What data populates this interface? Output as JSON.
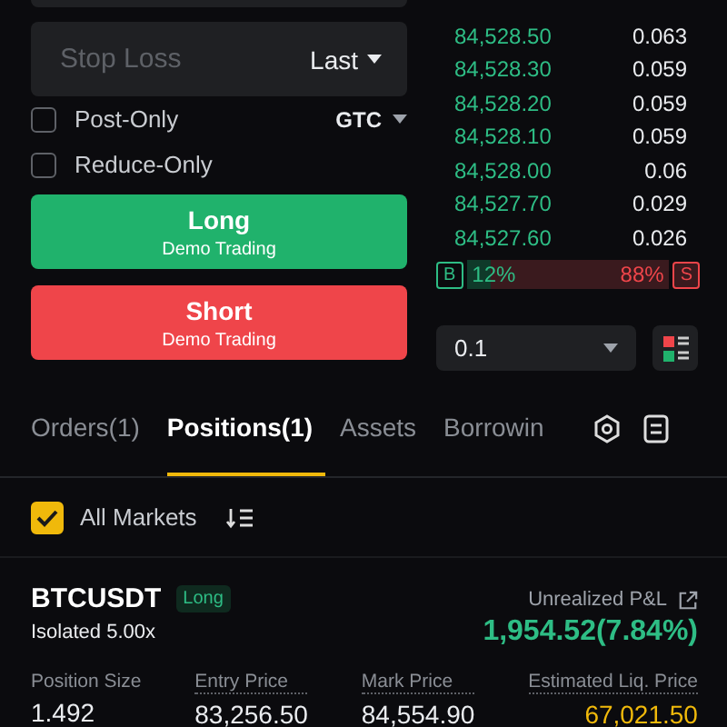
{
  "order_form": {
    "stop_loss": {
      "placeholder": "Stop Loss",
      "trigger": "Last"
    },
    "options": [
      {
        "label": "Post-Only",
        "checked": false
      },
      {
        "label": "Reduce-Only",
        "checked": false
      }
    ],
    "time_in_force": "GTC",
    "buttons": [
      {
        "kind": "long",
        "label": "Long",
        "sub": "Demo Trading"
      },
      {
        "kind": "short",
        "label": "Short",
        "sub": "Demo Trading"
      }
    ]
  },
  "order_book": {
    "rows": [
      {
        "price": "84,528.50",
        "qty": "0.063"
      },
      {
        "price": "84,528.30",
        "qty": "0.059"
      },
      {
        "price": "84,528.20",
        "qty": "0.059"
      },
      {
        "price": "84,528.10",
        "qty": "0.059"
      },
      {
        "price": "84,528.00",
        "qty": "0.06"
      },
      {
        "price": "84,527.70",
        "qty": "0.029"
      },
      {
        "price": "84,527.60",
        "qty": "0.026"
      }
    ],
    "ratio": {
      "buy_tag": "B",
      "buy": "12%",
      "sell": "88%",
      "sell_tag": "S",
      "level": 0.12
    },
    "precision": "0.1"
  },
  "tabs": [
    {
      "label": "Orders(1)",
      "selected": false
    },
    {
      "label": "Positions(1)",
      "selected": true
    },
    {
      "label": "Assets",
      "selected": false
    },
    {
      "label": "Borrowin",
      "selected": false
    }
  ],
  "filter": {
    "label": "All Markets",
    "checked": true
  },
  "position": {
    "symbol": "BTCUSDT",
    "side": "Long",
    "margin": "Isolated 5.00x",
    "pnl_label": "Unrealized P&L",
    "pnl": "1,954.52(7.84%)",
    "fields": [
      {
        "label": "Position Size",
        "value": "1.492"
      },
      {
        "label": "Entry Price",
        "value": "83,256.50"
      },
      {
        "label": "Mark Price",
        "value": "84,554.90"
      },
      {
        "label": "Estimated Liq. Price",
        "value": "67,021.50"
      }
    ]
  }
}
